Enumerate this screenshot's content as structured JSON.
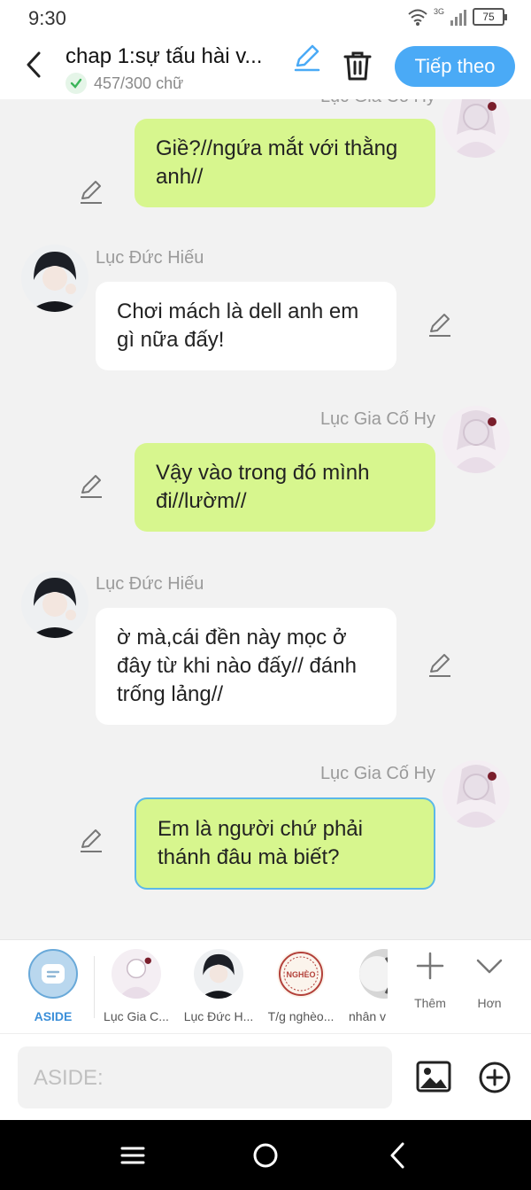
{
  "status_bar": {
    "time": "9:30",
    "network": "3G",
    "battery": "75"
  },
  "header": {
    "title": "chap 1:sự tấu hài v...",
    "word_count": "457/300 chữ",
    "next_label": "Tiếp theo"
  },
  "messages": [
    {
      "side": "right",
      "name": "Lục Gia Cố Hy",
      "text": "Giề?//ngứa mắt với thằng anh//"
    },
    {
      "side": "left",
      "name": "Lục Đức Hiếu",
      "text": "Chơi mách là dell anh em gì nữa đấy!"
    },
    {
      "side": "right",
      "name": "Lục Gia Cố Hy",
      "text": "Vậy vào trong đó mình đi//lườm//"
    },
    {
      "side": "left",
      "name": "Lục Đức Hiếu",
      "text": "ờ mà,cái đền này mọc ở đây từ khi nào đấy// đánh trống lảng//"
    },
    {
      "side": "right",
      "name": "Lục Gia Cố Hy",
      "text": "Em là người chứ phải thánh đâu mà biết?"
    }
  ],
  "characters": [
    {
      "label": "ASIDE"
    },
    {
      "label": "Lục Gia C..."
    },
    {
      "label": "Lục Đức H..."
    },
    {
      "label": "T/g nghèo..."
    },
    {
      "label": "nhân v"
    }
  ],
  "seal_text": "NGHÈO",
  "tools": {
    "more": "Thêm",
    "less": "Hơn"
  },
  "composer": {
    "placeholder": "ASIDE:"
  },
  "colors": {
    "accent": "#4aaaf6",
    "bubble_green": "#d7f68e"
  }
}
